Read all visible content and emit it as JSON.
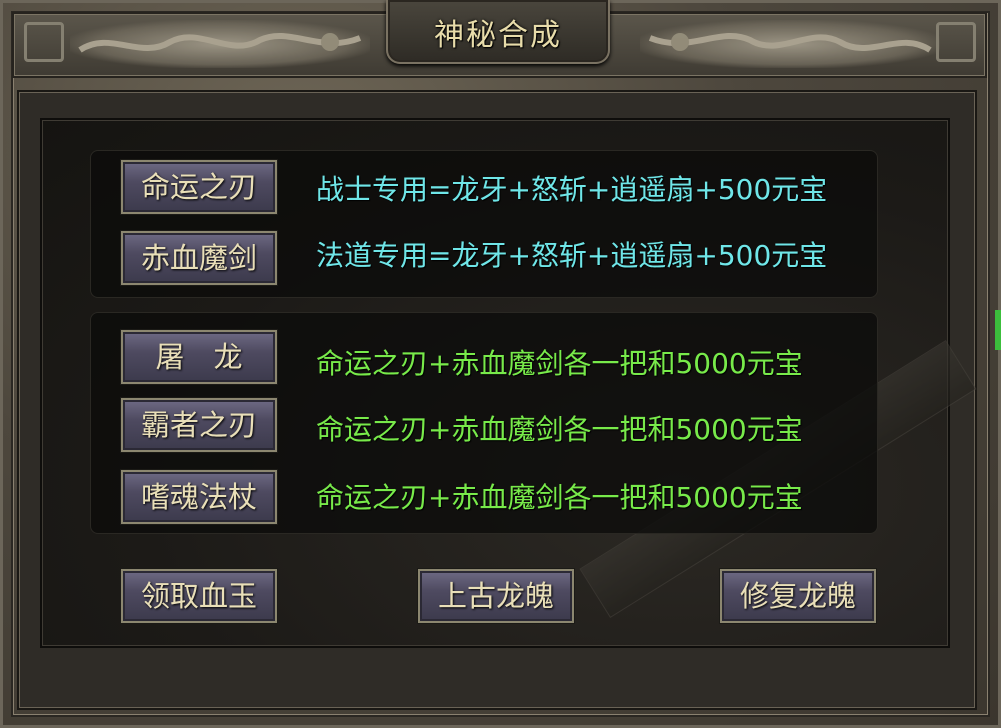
{
  "window": {
    "title": "神秘合成"
  },
  "recipes": {
    "group1": [
      {
        "button": "命运之刃",
        "desc": "战士专用=龙牙+怒斩+逍遥扇+500元宝"
      },
      {
        "button": "赤血魔剑",
        "desc": "法道专用=龙牙+怒斩+逍遥扇+500元宝"
      }
    ],
    "group2": [
      {
        "button": "屠　龙",
        "desc": "命运之刃+赤血魔剑各一把和5000元宝"
      },
      {
        "button": "霸者之刃",
        "desc": "命运之刃+赤血魔剑各一把和5000元宝"
      },
      {
        "button": "嗜魂法杖",
        "desc": "命运之刃+赤血魔剑各一把和5000元宝"
      }
    ]
  },
  "actions": {
    "claim": "领取血玉",
    "ancient_soul": "上古龙魄",
    "repair_soul": "修复龙魄"
  },
  "colors": {
    "group1_text": "#6fe6e8",
    "group2_text": "#78ea4a",
    "title_text": "#e8dcaa",
    "button_text": "#e9dfb8"
  },
  "icons": {
    "banner_left": "dragon-icon",
    "banner_right": "dragon-icon"
  }
}
